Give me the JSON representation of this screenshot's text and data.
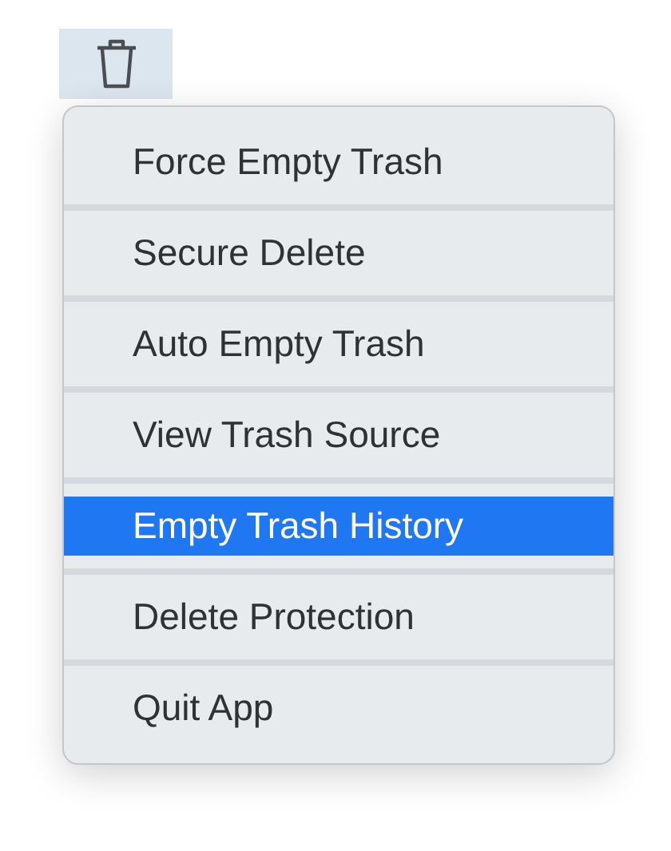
{
  "toolbar": {
    "trash_button": {
      "selected": true
    }
  },
  "menu": {
    "items": [
      {
        "label": "Force Empty Trash",
        "selected": false
      },
      {
        "label": "Secure Delete",
        "selected": false
      },
      {
        "label": "Auto Empty Trash",
        "selected": false
      },
      {
        "label": "View Trash Source",
        "selected": false
      },
      {
        "label": "Empty Trash History",
        "selected": true
      },
      {
        "label": "Delete Protection",
        "selected": false
      },
      {
        "label": "Quit App",
        "selected": false
      }
    ]
  }
}
